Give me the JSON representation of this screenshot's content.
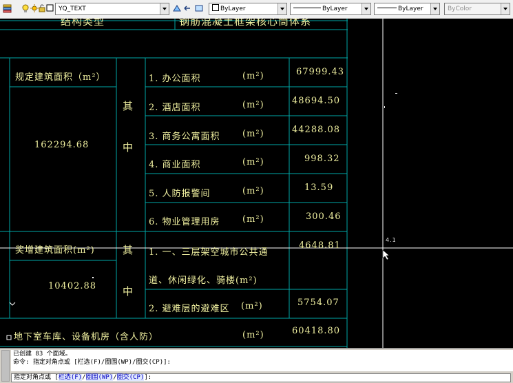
{
  "toolbar": {
    "layer_name": "YQ_TEXT",
    "color_value": "ByLayer",
    "linetype_value": "ByLayer",
    "lineweight_value": "ByLayer",
    "plotstyle_value": "ByColor",
    "icons": [
      "layer-properties-icon",
      "lightbulb-icon",
      "sun-icon",
      "lock-icon",
      "color-swatch-icon",
      "make-current-icon",
      "layer-previous-icon",
      "layer-match-icon"
    ]
  },
  "drawing": {
    "title_left": "结构类型",
    "title_right": "钢筋混凝土框架核心筒体系",
    "area_required_label": "规定建筑面积（m²）",
    "area_required_value": "162294.68",
    "qi_1": "其",
    "zhong_1": "中",
    "rows": [
      {
        "name": "1. 办公面积",
        "unit": "(m²)",
        "value": "67999.43"
      },
      {
        "name": "2. 酒店面积",
        "unit": "(m²)",
        "value": "48694.50"
      },
      {
        "name": "3. 商务公寓面积",
        "unit": "(m²)",
        "value": "44288.08"
      },
      {
        "name": "4. 商业面积",
        "unit": "(m²)",
        "value": "998.32"
      },
      {
        "name": "5. 人防报警间",
        "unit": "(m²)",
        "value": "13.59"
      },
      {
        "name": "6. 物业管理用房",
        "unit": "(m²)",
        "value": "300.46"
      }
    ],
    "area_extra_label": "奖增建筑面积(m²)",
    "area_extra_value": "10402.88",
    "qi_2": "其",
    "zhong_2": "中",
    "extra_row1_line1": "1. 一、三层架空城市公共通",
    "extra_row1_line2": "道、休闲绿化、骑楼(m²)",
    "extra_row1_value": "4648.81",
    "extra_row2_name": "2. 避难层的避难区",
    "extra_row2_unit": "(m²)",
    "extra_row2_value": "5754.07",
    "basement_label": "地下室车库、设备机房（含人防）",
    "basement_unit": "(m²)",
    "basement_value": "60418.80",
    "coord_hint": "4.1"
  },
  "command": {
    "history_line1": "已创建 83 个面域。",
    "history_line2": "命令: 指定对角点或 [栏选(F)/圈围(WP)/圈交(CP)]:",
    "prompt_prefix": "指定对角点或 [",
    "opt_fence": "栏选(F)",
    "opt_wpoly": "圈围(WP)",
    "opt_cpoly": "圈交(CP)",
    "prompt_suffix": "]:"
  },
  "colors": {
    "canvas_bg": "#000000",
    "table_lines": "#00a8a8",
    "text": "#f0f0a0",
    "crosshair": "#ffffff",
    "toolbar_bg": "#f0f0f0"
  }
}
